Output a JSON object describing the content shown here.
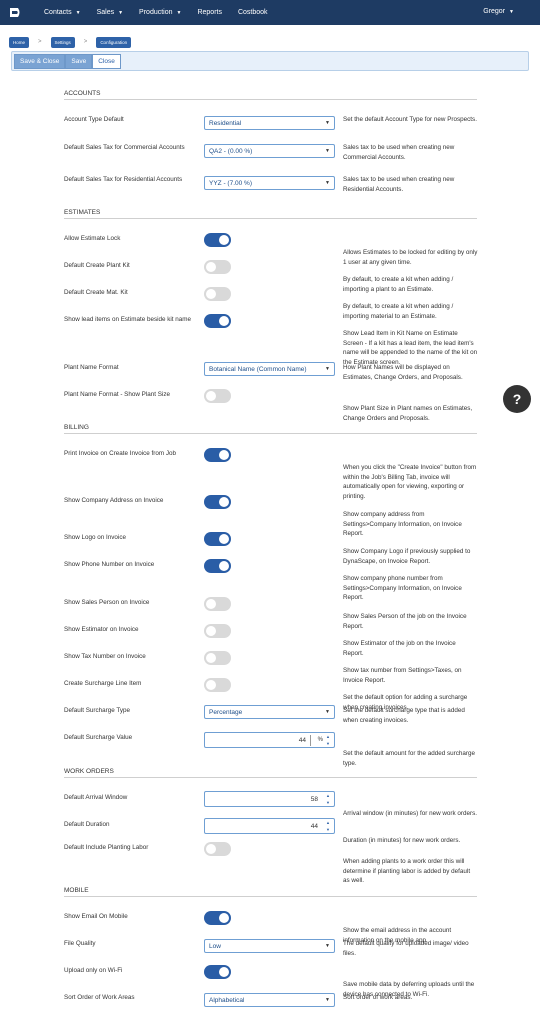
{
  "nav": {
    "items": [
      {
        "label": "Contacts",
        "caret": true
      },
      {
        "label": "Sales",
        "caret": true
      },
      {
        "label": "Production",
        "caret": true
      },
      {
        "label": "Reports",
        "caret": false
      },
      {
        "label": "Costbook",
        "caret": false
      }
    ],
    "user": "Gregor"
  },
  "breadcrumb": [
    "Home",
    "Settings",
    "Configuration"
  ],
  "toolbar": {
    "save_close": "Save & Close",
    "save": "Save",
    "close": "Close"
  },
  "help_label": "?",
  "sections": {
    "accounts": {
      "title": "ACCOUNTS",
      "account_type": {
        "label": "Account Type Default",
        "value": "Residential",
        "desc": "Set the default Account Type for new Prospects."
      },
      "sales_tax_commercial": {
        "label": "Default Sales Tax for Commercial Accounts",
        "value": "QA2 - (0.00 %)",
        "desc": "Sales tax to be used when creating new Commercial Accounts."
      },
      "sales_tax_residential": {
        "label": "Default Sales Tax for Residential Accounts",
        "value": "YYZ - (7.00 %)",
        "desc": "Sales tax to be used when creating new Residential Accounts."
      }
    },
    "estimates": {
      "title": "ESTIMATES",
      "estimate_lock": {
        "label": "Allow Estimate Lock",
        "on": true,
        "desc": "Allows Estimates to be locked for editing by only 1 user at any given time."
      },
      "plant_kit": {
        "label": "Default Create Plant Kit",
        "on": false,
        "desc": "By default, to create a kit when adding / importing a plant to an Estimate."
      },
      "mat_kit": {
        "label": "Default Create Mat. Kit",
        "on": false,
        "desc": "By default, to create a kit when adding / importing material to an Estimate."
      },
      "lead_items": {
        "label": "Show lead items on Estimate beside kit name",
        "on": true,
        "desc": "Show Lead Item in Kit Name on Estimate Screen - If a kit has a lead item, the lead item's name will be appended to the name of the kit on the Estimate screen."
      },
      "plant_name_format": {
        "label": "Plant Name Format",
        "value": "Botanical Name (Common Name)",
        "desc": "How Plant Names will be displayed on Estimates, Change Orders, and Proposals."
      },
      "plant_size": {
        "label": "Plant Name Format - Show Plant Size",
        "on": false,
        "desc": "Show Plant Size in Plant names on Estimates, Change Orders and Proposals."
      }
    },
    "billing": {
      "title": "BILLING",
      "print_invoice": {
        "label": "Print Invoice on Create Invoice from Job",
        "on": true,
        "desc": "When you click the \"Create Invoice\" button from within the Job's Billing Tab, invoice will automatically open for viewing, exporting or printing."
      },
      "company_address": {
        "label": "Show Company Address on Invoice",
        "on": true,
        "desc": "Show company address from Settings>Company Information, on Invoice Report."
      },
      "logo": {
        "label": "Show Logo on Invoice",
        "on": true,
        "desc": "Show Company Logo if previously supplied to DynaScape, on Invoice Report."
      },
      "phone": {
        "label": "Show Phone Number on Invoice",
        "on": true,
        "desc": "Show company phone number from Settings>Company Information, on Invoice Report."
      },
      "sales_person": {
        "label": "Show Sales Person on Invoice",
        "on": false,
        "desc": "Show Sales Person of the job on the Invoice Report."
      },
      "estimator": {
        "label": "Show Estimator on Invoice",
        "on": false,
        "desc": "Show Estimator of the job on the Invoice Report."
      },
      "tax_number": {
        "label": "Show Tax Number on Invoice",
        "on": false,
        "desc": "Show tax number from Settings>Taxes, on Invoice Report."
      },
      "surcharge_line": {
        "label": "Create Surcharge Line Item",
        "on": false,
        "desc": "Set the default option for adding a surcharge when creating invoices."
      },
      "surcharge_type": {
        "label": "Default Surcharge Type",
        "value": "Percentage",
        "desc": "Set the default surcharge type that is added when creating invoices."
      },
      "surcharge_value": {
        "label": "Default Surcharge Value",
        "value": "44",
        "unit": "%",
        "desc": "Set the default amount for the added surcharge type."
      }
    },
    "work_orders": {
      "title": "WORK ORDERS",
      "arrival_window": {
        "label": "Default Arrival Window",
        "value": "58",
        "desc": "Arrival window (in minutes) for new work orders."
      },
      "duration": {
        "label": "Default Duration",
        "value": "44",
        "desc": "Duration (in minutes) for new work orders."
      },
      "planting_labor": {
        "label": "Default Include Planting Labor",
        "on": false,
        "desc": "When adding plants to a work order this will determine if planting labor is added by default as well."
      }
    },
    "mobile": {
      "title": "MOBILE",
      "show_email": {
        "label": "Show Email On Mobile",
        "on": true,
        "desc": "Show the email address in the account information on the mobile app."
      },
      "file_quality": {
        "label": "File Quality",
        "value": "Low",
        "desc": "The default quality for uploaded image/ video files."
      },
      "wifi_only": {
        "label": "Upload only on Wi-Fi",
        "on": true,
        "desc": "Save mobile data by deferring uploads until the device has connected to Wi-Fi."
      },
      "sort_order": {
        "label": "Sort Order of Work Areas",
        "value": "Alphabetical",
        "desc": "Sort order of work areas."
      }
    }
  }
}
